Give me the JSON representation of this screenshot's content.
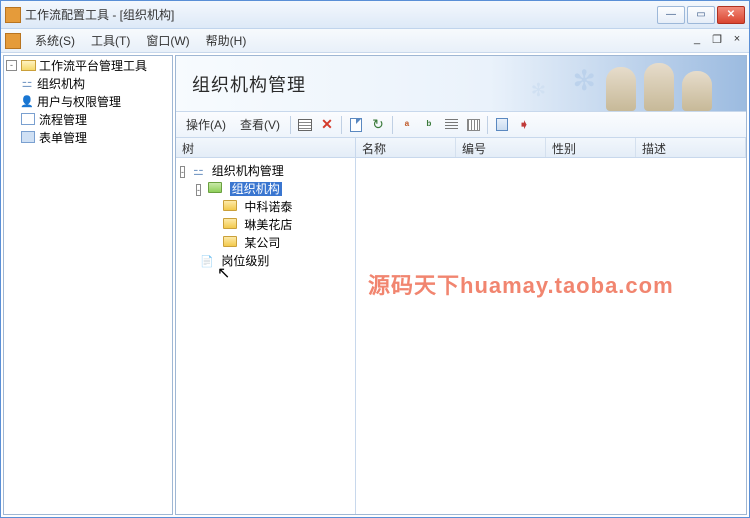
{
  "window": {
    "title": "工作流配置工具 - [组织机构]"
  },
  "menu": {
    "system": "系统(S)",
    "tools": "工具(T)",
    "window": "窗口(W)",
    "help": "帮助(H)"
  },
  "nav": {
    "root": "工作流平台管理工具",
    "items": [
      {
        "label": "组织机构",
        "icon": "org"
      },
      {
        "label": "用户与权限管理",
        "icon": "user"
      },
      {
        "label": "流程管理",
        "icon": "proc"
      },
      {
        "label": "表单管理",
        "icon": "form"
      }
    ]
  },
  "banner": {
    "title": "组织机构管理"
  },
  "toolbar": {
    "action": "操作(A)",
    "view": "查看(V)"
  },
  "treepane": {
    "header": "树",
    "root": "组织机构管理",
    "org_node": "组织机构",
    "children": [
      "中科诺泰",
      "琳美花店",
      "某公司"
    ],
    "position_node": "岗位级别"
  },
  "list": {
    "columns": {
      "name": "名称",
      "code": "编号",
      "sex": "性别",
      "desc": "描述"
    }
  },
  "watermark": "源码天下huamay.taoba.com"
}
